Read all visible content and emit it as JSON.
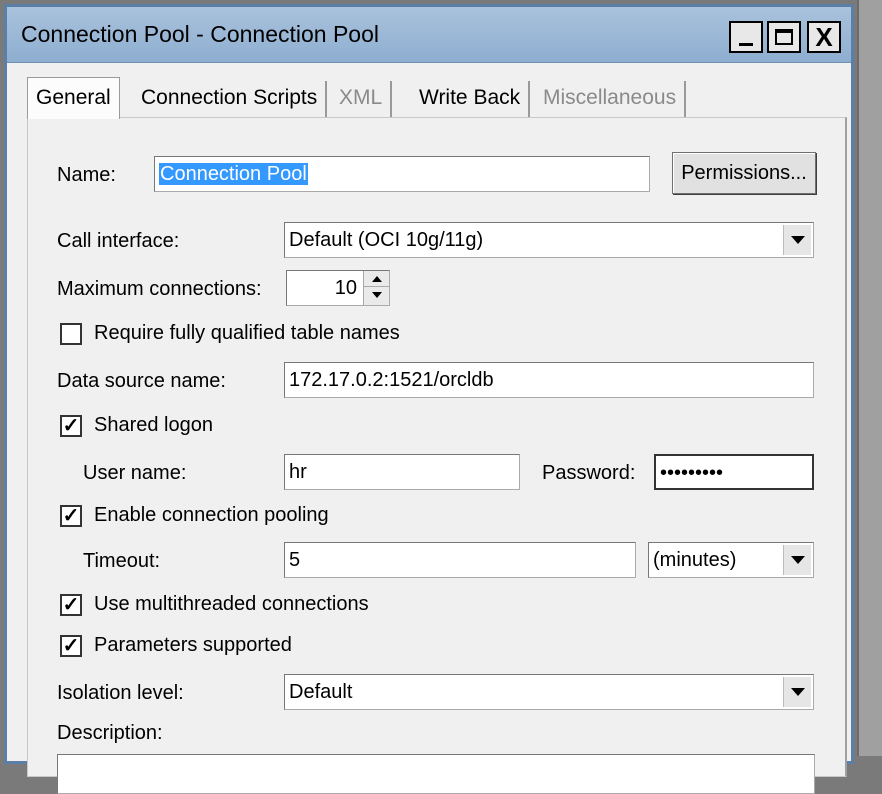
{
  "window": {
    "title": "Connection Pool - Connection Pool",
    "minimize_icon": "minimize-icon",
    "maximize_icon": "maximize-icon",
    "close_glyph": "X"
  },
  "tabs": [
    {
      "label": "General",
      "active": true,
      "enabled": true
    },
    {
      "label": "Connection Scripts",
      "active": false,
      "enabled": true
    },
    {
      "label": "XML",
      "active": false,
      "enabled": false
    },
    {
      "label": "Write Back",
      "active": false,
      "enabled": true
    },
    {
      "label": "Miscellaneous",
      "active": false,
      "enabled": false
    }
  ],
  "form": {
    "name_label": "Name:",
    "name_value": "Connection Pool",
    "permissions_label": "Permissions...",
    "call_interface_label": "Call interface:",
    "call_interface_value": "Default (OCI 10g/11g)",
    "max_connections_label": "Maximum connections:",
    "max_connections_value": "10",
    "require_fq_label": "Require fully qualified table names",
    "require_fq_checked": false,
    "dsn_label": "Data source name:",
    "dsn_value": "172.17.0.2:1521/orcldb",
    "shared_logon_label": "Shared logon",
    "shared_logon_checked": true,
    "user_name_label": "User name:",
    "user_name_value": "hr",
    "password_label": "Password:",
    "password_value": "•••••••••",
    "enable_pooling_label": "Enable connection pooling",
    "enable_pooling_checked": true,
    "timeout_label": "Timeout:",
    "timeout_value": "5",
    "timeout_unit": "(minutes)",
    "multithreaded_label": "Use multithreaded connections",
    "multithreaded_checked": true,
    "params_supported_label": "Parameters supported",
    "params_supported_checked": true,
    "isolation_label": "Isolation level:",
    "isolation_value": "Default",
    "description_label": "Description:"
  },
  "checkmark": "✓"
}
